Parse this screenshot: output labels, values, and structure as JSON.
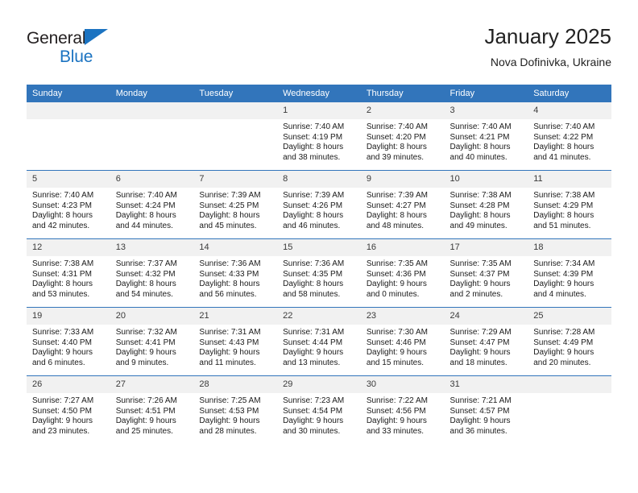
{
  "brand": {
    "name_part1": "General",
    "name_part2": "Blue",
    "logo_icon": "blue-triangle-icon"
  },
  "header": {
    "title": "January 2025",
    "location": "Nova Dofinivka, Ukraine"
  },
  "colors": {
    "header_blue": "#3275bb",
    "brand_blue": "#1b73c1",
    "daynum_strip": "#f1f1f1",
    "text": "#1a1a1a"
  },
  "weekday_headers": [
    "Sunday",
    "Monday",
    "Tuesday",
    "Wednesday",
    "Thursday",
    "Friday",
    "Saturday"
  ],
  "weeks": [
    [
      {
        "day": "",
        "empty": true
      },
      {
        "day": "",
        "empty": true
      },
      {
        "day": "",
        "empty": true
      },
      {
        "day": "1",
        "sunrise": "Sunrise: 7:40 AM",
        "sunset": "Sunset: 4:19 PM",
        "daylight_line1": "Daylight: 8 hours",
        "daylight_line2": "and 38 minutes."
      },
      {
        "day": "2",
        "sunrise": "Sunrise: 7:40 AM",
        "sunset": "Sunset: 4:20 PM",
        "daylight_line1": "Daylight: 8 hours",
        "daylight_line2": "and 39 minutes."
      },
      {
        "day": "3",
        "sunrise": "Sunrise: 7:40 AM",
        "sunset": "Sunset: 4:21 PM",
        "daylight_line1": "Daylight: 8 hours",
        "daylight_line2": "and 40 minutes."
      },
      {
        "day": "4",
        "sunrise": "Sunrise: 7:40 AM",
        "sunset": "Sunset: 4:22 PM",
        "daylight_line1": "Daylight: 8 hours",
        "daylight_line2": "and 41 minutes."
      }
    ],
    [
      {
        "day": "5",
        "sunrise": "Sunrise: 7:40 AM",
        "sunset": "Sunset: 4:23 PM",
        "daylight_line1": "Daylight: 8 hours",
        "daylight_line2": "and 42 minutes."
      },
      {
        "day": "6",
        "sunrise": "Sunrise: 7:40 AM",
        "sunset": "Sunset: 4:24 PM",
        "daylight_line1": "Daylight: 8 hours",
        "daylight_line2": "and 44 minutes."
      },
      {
        "day": "7",
        "sunrise": "Sunrise: 7:39 AM",
        "sunset": "Sunset: 4:25 PM",
        "daylight_line1": "Daylight: 8 hours",
        "daylight_line2": "and 45 minutes."
      },
      {
        "day": "8",
        "sunrise": "Sunrise: 7:39 AM",
        "sunset": "Sunset: 4:26 PM",
        "daylight_line1": "Daylight: 8 hours",
        "daylight_line2": "and 46 minutes."
      },
      {
        "day": "9",
        "sunrise": "Sunrise: 7:39 AM",
        "sunset": "Sunset: 4:27 PM",
        "daylight_line1": "Daylight: 8 hours",
        "daylight_line2": "and 48 minutes."
      },
      {
        "day": "10",
        "sunrise": "Sunrise: 7:38 AM",
        "sunset": "Sunset: 4:28 PM",
        "daylight_line1": "Daylight: 8 hours",
        "daylight_line2": "and 49 minutes."
      },
      {
        "day": "11",
        "sunrise": "Sunrise: 7:38 AM",
        "sunset": "Sunset: 4:29 PM",
        "daylight_line1": "Daylight: 8 hours",
        "daylight_line2": "and 51 minutes."
      }
    ],
    [
      {
        "day": "12",
        "sunrise": "Sunrise: 7:38 AM",
        "sunset": "Sunset: 4:31 PM",
        "daylight_line1": "Daylight: 8 hours",
        "daylight_line2": "and 53 minutes."
      },
      {
        "day": "13",
        "sunrise": "Sunrise: 7:37 AM",
        "sunset": "Sunset: 4:32 PM",
        "daylight_line1": "Daylight: 8 hours",
        "daylight_line2": "and 54 minutes."
      },
      {
        "day": "14",
        "sunrise": "Sunrise: 7:36 AM",
        "sunset": "Sunset: 4:33 PM",
        "daylight_line1": "Daylight: 8 hours",
        "daylight_line2": "and 56 minutes."
      },
      {
        "day": "15",
        "sunrise": "Sunrise: 7:36 AM",
        "sunset": "Sunset: 4:35 PM",
        "daylight_line1": "Daylight: 8 hours",
        "daylight_line2": "and 58 minutes."
      },
      {
        "day": "16",
        "sunrise": "Sunrise: 7:35 AM",
        "sunset": "Sunset: 4:36 PM",
        "daylight_line1": "Daylight: 9 hours",
        "daylight_line2": "and 0 minutes."
      },
      {
        "day": "17",
        "sunrise": "Sunrise: 7:35 AM",
        "sunset": "Sunset: 4:37 PM",
        "daylight_line1": "Daylight: 9 hours",
        "daylight_line2": "and 2 minutes."
      },
      {
        "day": "18",
        "sunrise": "Sunrise: 7:34 AM",
        "sunset": "Sunset: 4:39 PM",
        "daylight_line1": "Daylight: 9 hours",
        "daylight_line2": "and 4 minutes."
      }
    ],
    [
      {
        "day": "19",
        "sunrise": "Sunrise: 7:33 AM",
        "sunset": "Sunset: 4:40 PM",
        "daylight_line1": "Daylight: 9 hours",
        "daylight_line2": "and 6 minutes."
      },
      {
        "day": "20",
        "sunrise": "Sunrise: 7:32 AM",
        "sunset": "Sunset: 4:41 PM",
        "daylight_line1": "Daylight: 9 hours",
        "daylight_line2": "and 9 minutes."
      },
      {
        "day": "21",
        "sunrise": "Sunrise: 7:31 AM",
        "sunset": "Sunset: 4:43 PM",
        "daylight_line1": "Daylight: 9 hours",
        "daylight_line2": "and 11 minutes."
      },
      {
        "day": "22",
        "sunrise": "Sunrise: 7:31 AM",
        "sunset": "Sunset: 4:44 PM",
        "daylight_line1": "Daylight: 9 hours",
        "daylight_line2": "and 13 minutes."
      },
      {
        "day": "23",
        "sunrise": "Sunrise: 7:30 AM",
        "sunset": "Sunset: 4:46 PM",
        "daylight_line1": "Daylight: 9 hours",
        "daylight_line2": "and 15 minutes."
      },
      {
        "day": "24",
        "sunrise": "Sunrise: 7:29 AM",
        "sunset": "Sunset: 4:47 PM",
        "daylight_line1": "Daylight: 9 hours",
        "daylight_line2": "and 18 minutes."
      },
      {
        "day": "25",
        "sunrise": "Sunrise: 7:28 AM",
        "sunset": "Sunset: 4:49 PM",
        "daylight_line1": "Daylight: 9 hours",
        "daylight_line2": "and 20 minutes."
      }
    ],
    [
      {
        "day": "26",
        "sunrise": "Sunrise: 7:27 AM",
        "sunset": "Sunset: 4:50 PM",
        "daylight_line1": "Daylight: 9 hours",
        "daylight_line2": "and 23 minutes."
      },
      {
        "day": "27",
        "sunrise": "Sunrise: 7:26 AM",
        "sunset": "Sunset: 4:51 PM",
        "daylight_line1": "Daylight: 9 hours",
        "daylight_line2": "and 25 minutes."
      },
      {
        "day": "28",
        "sunrise": "Sunrise: 7:25 AM",
        "sunset": "Sunset: 4:53 PM",
        "daylight_line1": "Daylight: 9 hours",
        "daylight_line2": "and 28 minutes."
      },
      {
        "day": "29",
        "sunrise": "Sunrise: 7:23 AM",
        "sunset": "Sunset: 4:54 PM",
        "daylight_line1": "Daylight: 9 hours",
        "daylight_line2": "and 30 minutes."
      },
      {
        "day": "30",
        "sunrise": "Sunrise: 7:22 AM",
        "sunset": "Sunset: 4:56 PM",
        "daylight_line1": "Daylight: 9 hours",
        "daylight_line2": "and 33 minutes."
      },
      {
        "day": "31",
        "sunrise": "Sunrise: 7:21 AM",
        "sunset": "Sunset: 4:57 PM",
        "daylight_line1": "Daylight: 9 hours",
        "daylight_line2": "and 36 minutes."
      },
      {
        "day": "",
        "empty": true
      }
    ]
  ]
}
